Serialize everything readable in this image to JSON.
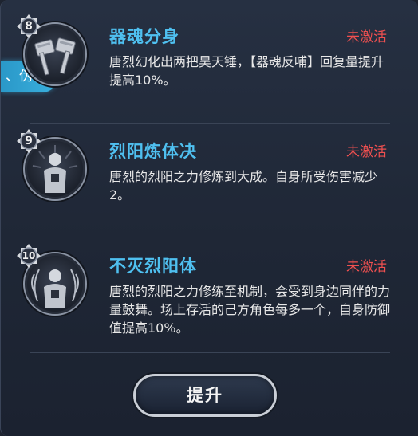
{
  "side_tab": {
    "label": "、伪装"
  },
  "skills": [
    {
      "level": "8",
      "name": "器魂分身",
      "status": "未激活",
      "description": "唐烈幻化出两把昊天锤，【器魂反哺】回复量提升提高10%。",
      "icon": "twin-hammers-icon"
    },
    {
      "level": "9",
      "name": "烈阳炼体决",
      "status": "未激活",
      "description": "唐烈的烈阳之力修炼到大成。自身所受伤害减少2。",
      "icon": "radiant-body-icon"
    },
    {
      "level": "10",
      "name": "不灭烈阳体",
      "status": "未激活",
      "description": "唐烈的烈阳之力修练至机制，会受到身边同伴的力量鼓舞。场上存活的己方角色每多一个，自身防御值提高10%。",
      "icon": "undying-body-icon"
    }
  ],
  "upgrade_button": {
    "label": "提升"
  },
  "colors": {
    "skill_name": "#4fc0f0",
    "status_inactive": "#f05050",
    "side_tab": "#2a98c8"
  }
}
